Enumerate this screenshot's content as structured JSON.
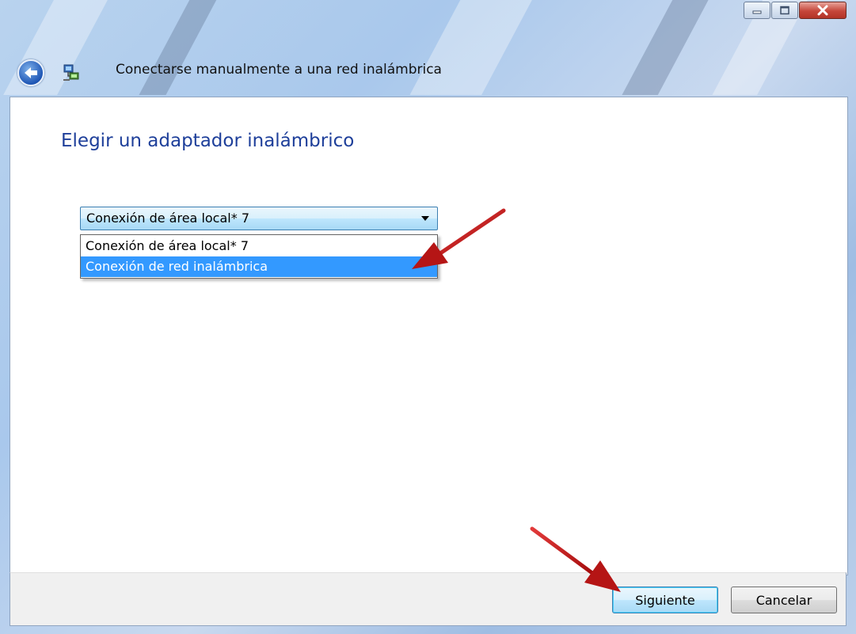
{
  "window": {
    "title": "Conectarse manualmente a una red inalámbrica",
    "controls": {
      "minimize": "minimize-icon",
      "maximize": "maximize-icon",
      "close": "close-icon"
    }
  },
  "nav": {
    "back_icon": "back-arrow-icon",
    "app_icon": "network-icon"
  },
  "main": {
    "heading": "Elegir un adaptador inalámbrico",
    "adapter_select": {
      "selected_value": "Conexión de área local* 7",
      "options": [
        {
          "label": "Conexión de área local* 7",
          "highlighted": false
        },
        {
          "label": "Conexión de red inalámbrica",
          "highlighted": true
        }
      ]
    }
  },
  "footer": {
    "next_label": "Siguiente",
    "cancel_label": "Cancelar"
  },
  "colors": {
    "heading": "#1e3f9a",
    "highlight": "#3399ff",
    "annotation_arrow": "#cc1111"
  }
}
